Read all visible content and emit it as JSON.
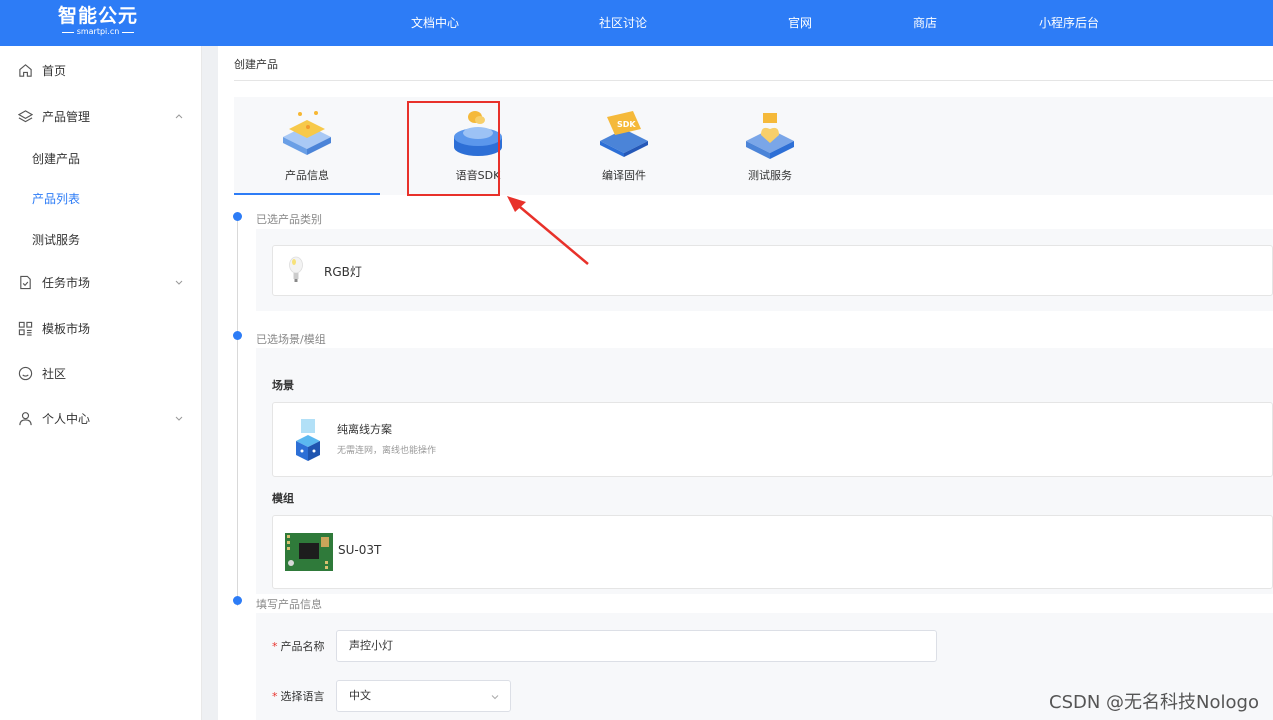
{
  "header": {
    "logo_title": "智能公元",
    "logo_sub": "smartpi.cn",
    "nav": [
      "文档中心",
      "社区讨论",
      "官网",
      "商店",
      "小程序后台"
    ]
  },
  "sidebar": {
    "home": "首页",
    "product_mgmt": "产品管理",
    "create_product": "创建产品",
    "product_list": "产品列表",
    "test_service": "测试服务",
    "task_market": "任务市场",
    "template_market": "模板市场",
    "community": "社区",
    "personal_center": "个人中心"
  },
  "main": {
    "title": "创建产品",
    "tabs": [
      {
        "label": "产品信息",
        "icon": "product-info-icon"
      },
      {
        "label": "语音SDK",
        "icon": "voice-sdk-icon"
      },
      {
        "label": "编译固件",
        "icon": "compile-firmware-icon"
      },
      {
        "label": "测试服务",
        "icon": "test-service-icon"
      }
    ],
    "active_tab": "产品信息",
    "section_category": "已选产品类别",
    "category_name": "RGB灯",
    "section_scene": "已选场景/模组",
    "scene_head": "场景",
    "scene_name": "纯离线方案",
    "scene_desc": "无需连网，离线也能操作",
    "module_head": "模组",
    "module_name": "SU-03T",
    "section_info": "填写产品信息",
    "name_label": "产品名称",
    "name_value": "声控小灯",
    "lang_label": "选择语言",
    "lang_value": "中文"
  },
  "watermark": "CSDN @无名科技Nologo",
  "colors": {
    "primary": "#2d7cf6",
    "highlight": "#e8312a"
  }
}
